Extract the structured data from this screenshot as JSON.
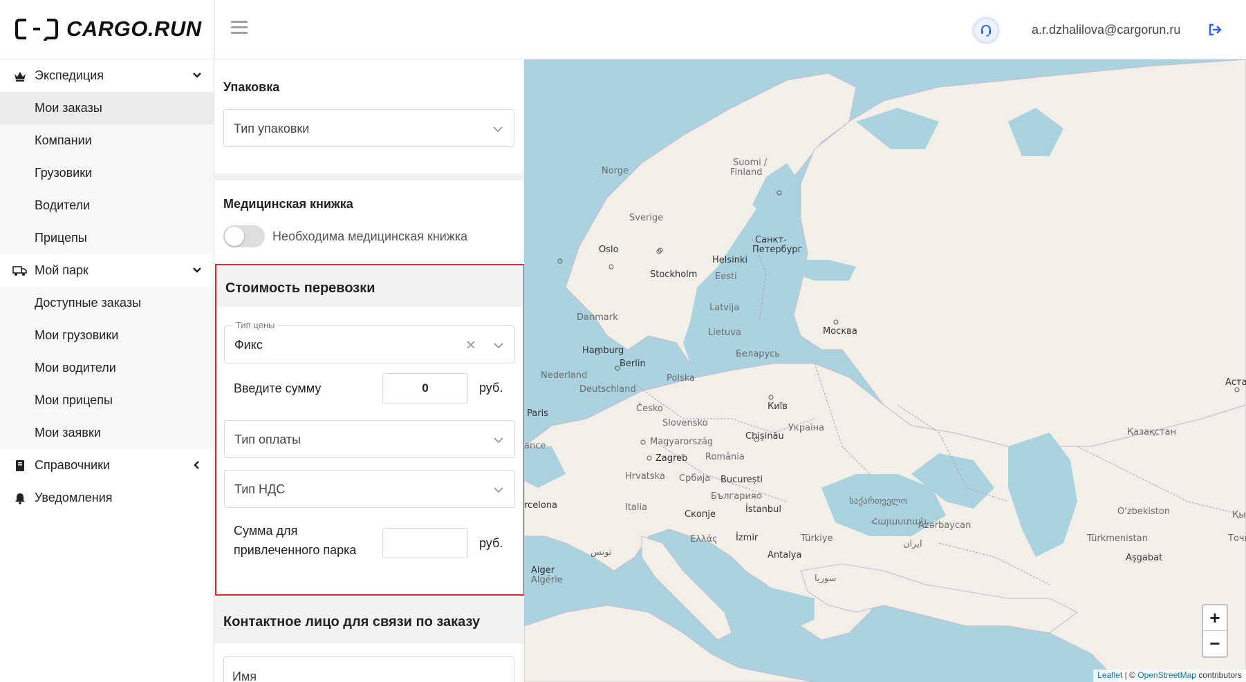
{
  "brand": {
    "logo_text": "CARGO.RUN"
  },
  "header": {
    "user_email": "a.r.dzhalilova@cargorun.ru"
  },
  "sidebar": {
    "groups": [
      {
        "label": "Экспедиция",
        "icon": "crown-icon",
        "items": [
          "Мои заказы",
          "Компании",
          "Грузовики",
          "Водители",
          "Прицепы"
        ],
        "active": "Мои заказы"
      },
      {
        "label": "Мой парк",
        "icon": "truck-icon",
        "items": [
          "Доступные заказы",
          "Мои грузовики",
          "Мои водители",
          "Мои прицепы",
          "Мои заявки"
        ]
      },
      {
        "label": "Справочники",
        "icon": "book-icon",
        "items": []
      },
      {
        "label": "Уведомления",
        "icon": "bell-icon",
        "items": []
      }
    ]
  },
  "form": {
    "packaging": {
      "title": "Упаковка",
      "placeholder": "Тип упаковки"
    },
    "medical": {
      "title": "Медицинская книжка",
      "toggle_label": "Необходима медицинская книжка",
      "enabled": false
    },
    "cost": {
      "title": "Стоимость перевозки",
      "price_type_label": "Тип цены",
      "price_type_value": "Фикс",
      "amount_label": "Введите сумму",
      "amount_value": "0",
      "unit": "руб.",
      "payment_type_placeholder": "Тип оплаты",
      "vat_type_placeholder": "Тип НДС",
      "fleet_amount_label_1": "Сумма для",
      "fleet_amount_label_2": "привлеченного парка",
      "fleet_amount_value": ""
    },
    "contact": {
      "title": "Контактное лицо для связи по заказу",
      "name_placeholder": "Имя"
    }
  },
  "map": {
    "labels": [
      "Norge",
      "Suomi /",
      "Finland",
      "Sverige",
      "Oslo",
      "Helsinki",
      "Санкт-",
      "Петербург",
      "Stockholm",
      "Eesti",
      "Latvija",
      "Danmark",
      "Lietuva",
      "Москва",
      "Hamburg",
      "Berlin",
      "Беларусь",
      "Nederland",
      "Deutschland",
      "Polska",
      "Астана",
      "Paris",
      "Česko",
      "Київ",
      "Slovensko",
      "Chișinău",
      "Україна",
      "ance",
      "Magyarország",
      "Қазақстан",
      "Zagreb",
      "România",
      "Hrvatska",
      "Србија",
      "București",
      "България",
      "rcelona",
      "Italia",
      "Скопје",
      "İstanbul",
      "საქართველო",
      "O'zbekiston",
      "Қы",
      "Ελλάς",
      "İzmir",
      "Türkiye",
      "Հայաստան",
      "Azərbaycan",
      "Türkmenistan",
      "Точи",
      "ایران",
      "تونس",
      "Antalya",
      "Aşgabat",
      "Alger",
      "Algérie",
      "سوريا"
    ],
    "zoom_in": "+",
    "zoom_out": "−",
    "attribution_link1": "Leaflet",
    "attribution_sep": " | © ",
    "attribution_link2": "OpenStreetMap",
    "attribution_tail": " contributors"
  },
  "colors": {
    "accent": "#2d64f5",
    "highlight_border": "#e0262b",
    "water": "#aad3df",
    "land": "#f2efe9"
  }
}
